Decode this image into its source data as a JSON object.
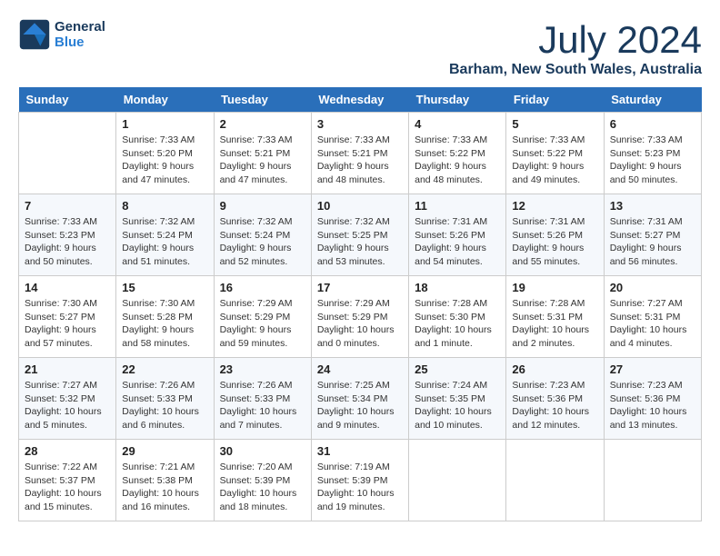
{
  "header": {
    "logo_line1": "General",
    "logo_line2": "Blue",
    "month_year": "July 2024",
    "location": "Barham, New South Wales, Australia"
  },
  "weekdays": [
    "Sunday",
    "Monday",
    "Tuesday",
    "Wednesday",
    "Thursday",
    "Friday",
    "Saturday"
  ],
  "weeks": [
    [
      {
        "day": "",
        "info": ""
      },
      {
        "day": "1",
        "info": "Sunrise: 7:33 AM\nSunset: 5:20 PM\nDaylight: 9 hours\nand 47 minutes."
      },
      {
        "day": "2",
        "info": "Sunrise: 7:33 AM\nSunset: 5:21 PM\nDaylight: 9 hours\nand 47 minutes."
      },
      {
        "day": "3",
        "info": "Sunrise: 7:33 AM\nSunset: 5:21 PM\nDaylight: 9 hours\nand 48 minutes."
      },
      {
        "day": "4",
        "info": "Sunrise: 7:33 AM\nSunset: 5:22 PM\nDaylight: 9 hours\nand 48 minutes."
      },
      {
        "day": "5",
        "info": "Sunrise: 7:33 AM\nSunset: 5:22 PM\nDaylight: 9 hours\nand 49 minutes."
      },
      {
        "day": "6",
        "info": "Sunrise: 7:33 AM\nSunset: 5:23 PM\nDaylight: 9 hours\nand 50 minutes."
      }
    ],
    [
      {
        "day": "7",
        "info": "Sunrise: 7:33 AM\nSunset: 5:23 PM\nDaylight: 9 hours\nand 50 minutes."
      },
      {
        "day": "8",
        "info": "Sunrise: 7:32 AM\nSunset: 5:24 PM\nDaylight: 9 hours\nand 51 minutes."
      },
      {
        "day": "9",
        "info": "Sunrise: 7:32 AM\nSunset: 5:24 PM\nDaylight: 9 hours\nand 52 minutes."
      },
      {
        "day": "10",
        "info": "Sunrise: 7:32 AM\nSunset: 5:25 PM\nDaylight: 9 hours\nand 53 minutes."
      },
      {
        "day": "11",
        "info": "Sunrise: 7:31 AM\nSunset: 5:26 PM\nDaylight: 9 hours\nand 54 minutes."
      },
      {
        "day": "12",
        "info": "Sunrise: 7:31 AM\nSunset: 5:26 PM\nDaylight: 9 hours\nand 55 minutes."
      },
      {
        "day": "13",
        "info": "Sunrise: 7:31 AM\nSunset: 5:27 PM\nDaylight: 9 hours\nand 56 minutes."
      }
    ],
    [
      {
        "day": "14",
        "info": "Sunrise: 7:30 AM\nSunset: 5:27 PM\nDaylight: 9 hours\nand 57 minutes."
      },
      {
        "day": "15",
        "info": "Sunrise: 7:30 AM\nSunset: 5:28 PM\nDaylight: 9 hours\nand 58 minutes."
      },
      {
        "day": "16",
        "info": "Sunrise: 7:29 AM\nSunset: 5:29 PM\nDaylight: 9 hours\nand 59 minutes."
      },
      {
        "day": "17",
        "info": "Sunrise: 7:29 AM\nSunset: 5:29 PM\nDaylight: 10 hours\nand 0 minutes."
      },
      {
        "day": "18",
        "info": "Sunrise: 7:28 AM\nSunset: 5:30 PM\nDaylight: 10 hours\nand 1 minute."
      },
      {
        "day": "19",
        "info": "Sunrise: 7:28 AM\nSunset: 5:31 PM\nDaylight: 10 hours\nand 2 minutes."
      },
      {
        "day": "20",
        "info": "Sunrise: 7:27 AM\nSunset: 5:31 PM\nDaylight: 10 hours\nand 4 minutes."
      }
    ],
    [
      {
        "day": "21",
        "info": "Sunrise: 7:27 AM\nSunset: 5:32 PM\nDaylight: 10 hours\nand 5 minutes."
      },
      {
        "day": "22",
        "info": "Sunrise: 7:26 AM\nSunset: 5:33 PM\nDaylight: 10 hours\nand 6 minutes."
      },
      {
        "day": "23",
        "info": "Sunrise: 7:26 AM\nSunset: 5:33 PM\nDaylight: 10 hours\nand 7 minutes."
      },
      {
        "day": "24",
        "info": "Sunrise: 7:25 AM\nSunset: 5:34 PM\nDaylight: 10 hours\nand 9 minutes."
      },
      {
        "day": "25",
        "info": "Sunrise: 7:24 AM\nSunset: 5:35 PM\nDaylight: 10 hours\nand 10 minutes."
      },
      {
        "day": "26",
        "info": "Sunrise: 7:23 AM\nSunset: 5:36 PM\nDaylight: 10 hours\nand 12 minutes."
      },
      {
        "day": "27",
        "info": "Sunrise: 7:23 AM\nSunset: 5:36 PM\nDaylight: 10 hours\nand 13 minutes."
      }
    ],
    [
      {
        "day": "28",
        "info": "Sunrise: 7:22 AM\nSunset: 5:37 PM\nDaylight: 10 hours\nand 15 minutes."
      },
      {
        "day": "29",
        "info": "Sunrise: 7:21 AM\nSunset: 5:38 PM\nDaylight: 10 hours\nand 16 minutes."
      },
      {
        "day": "30",
        "info": "Sunrise: 7:20 AM\nSunset: 5:39 PM\nDaylight: 10 hours\nand 18 minutes."
      },
      {
        "day": "31",
        "info": "Sunrise: 7:19 AM\nSunset: 5:39 PM\nDaylight: 10 hours\nand 19 minutes."
      },
      {
        "day": "",
        "info": ""
      },
      {
        "day": "",
        "info": ""
      },
      {
        "day": "",
        "info": ""
      }
    ]
  ]
}
